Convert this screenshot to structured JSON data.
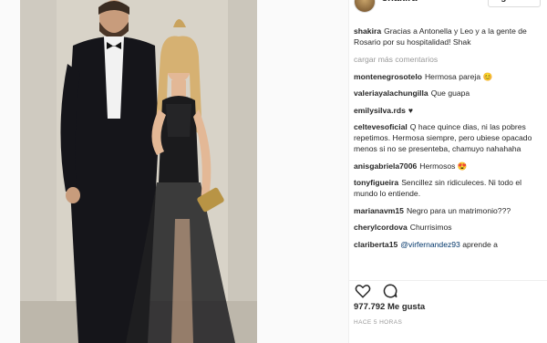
{
  "post": {
    "username": "shakira",
    "follow_label": "Siguiendo",
    "caption_user": "shakira",
    "caption_text": "Gracias a Antonella y Leo y a la gente de Rosario por su hospitalidad! Shak",
    "load_more": "cargar más comentarios",
    "likes": "977.792 Me gusta",
    "timestamp": "HACE 5 HORAS"
  },
  "comments": [
    {
      "user": "montenegrosotelo",
      "text": "Hermosa pareja 😊"
    },
    {
      "user": "valeriayalachungilla",
      "text": "Que guapa"
    },
    {
      "user": "emilysilva.rds",
      "text": "♥"
    },
    {
      "user": "celtevesoficial",
      "text": "Q hace quince dias, ni las pobres repetimos. Hermosa siempre, pero ubiese opacado menos si no se presenteba, chamuyo nahahaha"
    },
    {
      "user": "anisgabriela7006",
      "text": "Hermosos 😍"
    },
    {
      "user": "tonyfigueira",
      "text": "Sencillez sin ridiculeces. Ni todo el mundo lo entiende."
    },
    {
      "user": "marianavm15",
      "text": "Negro para un matrimonio???"
    },
    {
      "user": "cherylcordova",
      "text": "Churrisimos"
    },
    {
      "user": "clariberta15",
      "mention": "@virfernandez93",
      "text": "aprende a"
    }
  ],
  "icons": {
    "like": "heart-icon",
    "comment": "comment-bubble-icon"
  },
  "colors": {
    "text": "#262626",
    "muted": "#999999",
    "mention": "#003569",
    "border": "#dbdbdb"
  }
}
